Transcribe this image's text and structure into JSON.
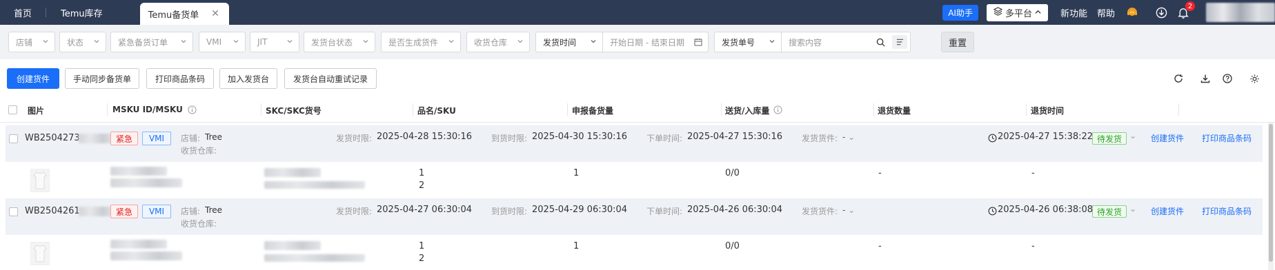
{
  "tabs": [
    {
      "label": "首页"
    },
    {
      "label": "Temu库存"
    },
    {
      "label": "Temu备货单"
    }
  ],
  "header": {
    "ai_label": "AI助手",
    "platform_label": "多平台",
    "new_features": "新功能",
    "help": "帮助",
    "notification_count": "2"
  },
  "filters": {
    "shop": "店铺",
    "status": "状态",
    "urgent": "紧急备货订单",
    "vmi": "VMI",
    "jit": "JIT",
    "ship_status": "发货台状态",
    "gen_cargo": "是否生成货件",
    "warehouse": "收货仓库",
    "ship_time": "发货时间",
    "date_placeholder": "开始日期 - 结束日期",
    "ship_no": "发货单号",
    "search_placeholder": "搜索内容",
    "reset": "重置"
  },
  "actions": {
    "create": "创建货件",
    "sync": "手动同步备货单",
    "print": "打印商品条码",
    "add_to_desk": "加入发货台",
    "retry_log": "发货台自动重试记录"
  },
  "columns": {
    "image": "图片",
    "msku": "MSKU ID/MSKU",
    "skc": "SKC/SKC货号",
    "name_sku": "品名/SKU",
    "declared": "申报备货量",
    "delivered": "送货/入库量",
    "return_qty": "退货数量",
    "return_time": "退货时间"
  },
  "labels": {
    "shop": "店铺:",
    "warehouse": "收货仓库:",
    "ship_deadline": "发货时限:",
    "arrive_deadline": "到货时限:",
    "order_time": "下单时间:",
    "ship_cargo": "发货货件:",
    "dash": "-"
  },
  "orders": [
    {
      "id": "WB2504273",
      "tag_urgent": "紧急",
      "tag_vmi": "VMI",
      "shop": "Tree",
      "ship_deadline": "2025-04-28 15:30:16",
      "arrive_deadline": "2025-04-30 15:30:16",
      "order_time": "2025-04-27 15:30:16",
      "status_time": "2025-04-27 15:38:22",
      "status": "待发货",
      "create_link": "创建货件",
      "print_link": "打印商品条码",
      "qty_1": "1",
      "qty_2": "2",
      "declared": "1",
      "delivered": "0/0",
      "return_qty": "-",
      "return_time": "-"
    },
    {
      "id": "WB2504261",
      "tag_urgent": "紧急",
      "tag_vmi": "VMI",
      "shop": "Tree",
      "ship_deadline": "2025-04-27 06:30:04",
      "arrive_deadline": "2025-04-29 06:30:04",
      "order_time": "2025-04-26 06:30:04",
      "status_time": "2025-04-26 06:38:08",
      "status": "待发货",
      "create_link": "创建货件",
      "print_link": "打印商品条码",
      "qty_1": "1",
      "qty_2": "2",
      "declared": "1",
      "delivered": "0/0",
      "return_qty": "-",
      "return_time": "-"
    }
  ]
}
